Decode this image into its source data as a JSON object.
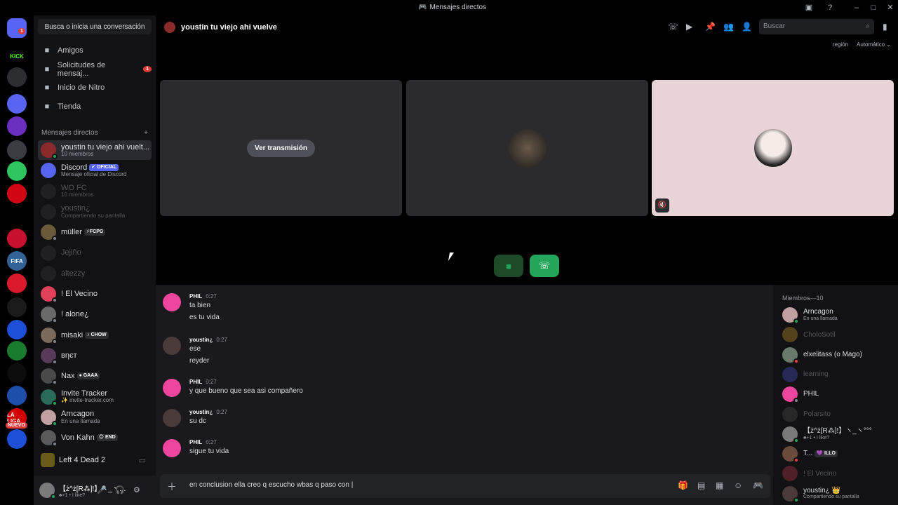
{
  "window": {
    "title": "Mensajes directos"
  },
  "server_rail": {
    "items": [
      {
        "label": "",
        "color": "#5865f2",
        "icon": "discord-home-icon",
        "badge": "1"
      },
      {
        "label": "KICK",
        "color": "#000000",
        "text_color": "#53fc18",
        "icon": "kick-icon"
      },
      {
        "label": "",
        "color": "#2b2d31",
        "icon": "server-group-icon"
      },
      {
        "label": "",
        "color": "#5865f2",
        "icon": "folder-icon"
      },
      {
        "label": "",
        "color": "#6b2fbf",
        "icon": "server-icon"
      },
      {
        "label": "",
        "color": "#3b3c42",
        "icon": "server-icon"
      },
      {
        "label": "",
        "color": "#2fc45d",
        "icon": "premier-league-icon"
      },
      {
        "label": "",
        "color": "#d20515",
        "icon": "bundesliga-icon"
      },
      {
        "label": "",
        "color": "#000000",
        "icon": "laliga-icon"
      },
      {
        "label": "",
        "color": "#c8102e",
        "icon": "server-icon"
      },
      {
        "label": "FIFA",
        "color": "#326295",
        "icon": "fifa-icon"
      },
      {
        "label": "",
        "color": "#d91a2a",
        "icon": "server-icon"
      },
      {
        "label": "",
        "color": "#1b1b1b",
        "icon": "server-icon"
      },
      {
        "label": "",
        "color": "#1e4fd8",
        "icon": "server-icon"
      },
      {
        "label": "",
        "color": "#1a7a2d",
        "icon": "server-icon"
      },
      {
        "label": "",
        "color": "#0d0d0d",
        "icon": "server-icon"
      },
      {
        "label": "",
        "color": "#1f4ea8",
        "icon": "server-icon"
      },
      {
        "label": "LA LIGA",
        "color": "#d30000",
        "icon": "laliga-icon",
        "badge": "NUEVO"
      },
      {
        "label": "",
        "color": "#1e4fd8",
        "icon": "server-icon"
      }
    ]
  },
  "sidebar": {
    "search_label": "Busca o inicia una conversación",
    "nav": [
      {
        "label": "Amigos",
        "icon": "friends-icon"
      },
      {
        "label": "Solicitudes de mensaj...",
        "icon": "inbox-icon",
        "badge": "1"
      },
      {
        "label": "Inicio de Nitro",
        "icon": "nitro-icon"
      },
      {
        "label": "Tienda",
        "icon": "shop-icon"
      }
    ],
    "dm_header": "Mensajes directos",
    "dms": [
      {
        "name": "youstin tu viejo ahi vuelt...",
        "sub": "10 miembros",
        "color": "#8a2a2a",
        "active": true,
        "dim": false,
        "status": "#23a55a"
      },
      {
        "name": "Discord",
        "tag": "✔ OFICIAL",
        "sub": "Mensaje oficial de Discord",
        "color": "#5865f2",
        "dim": false
      },
      {
        "name": "WO FC",
        "sub": "10 miembros",
        "color": "#3b3c42",
        "dim": true
      },
      {
        "name": "youstin¿",
        "sub": "Compartiendo su pantalla",
        "color": "#3b3c42",
        "dim": true
      },
      {
        "name": "müller",
        "tag": "⚡FCPG",
        "sub": "",
        "color": "#6a5a3a",
        "dim": false,
        "status": "#80848e"
      },
      {
        "name": "Jejiño",
        "sub": "",
        "color": "#3b3c42",
        "dim": true
      },
      {
        "name": "altezzy",
        "sub": "",
        "color": "#3b3c42",
        "dim": true
      },
      {
        "name": "! El Vecino",
        "sub": "",
        "color": "#e0405a",
        "dim": false,
        "status": "#80848e"
      },
      {
        "name": "! alone¿",
        "sub": "",
        "color": "#6a6a6a",
        "dim": false,
        "status": "#80848e"
      },
      {
        "name": "misaki",
        "tag": "♪ CHOW",
        "sub": "",
        "color": "#7a6a5a",
        "dim": false,
        "status": "#80848e"
      },
      {
        "name": "вηєт",
        "sub": "",
        "color": "#5a3a5a",
        "dim": false,
        "status": "#80848e"
      },
      {
        "name": "Nax",
        "tag": "● GAAA",
        "sub": "",
        "color": "#4a4a4a",
        "dim": false,
        "status": "#80848e"
      },
      {
        "name": "Invite Tracker",
        "sub": "✨ invite-tracker.com",
        "color": "#2a6a5a",
        "dim": false,
        "status": "#23a55a"
      },
      {
        "name": "Arncagon",
        "sub": "En una llamada",
        "color": "#c0a0a0",
        "dim": false,
        "status": "#23a55a"
      },
      {
        "name": "Von Kahn",
        "tag": "😊 END",
        "sub": "",
        "color": "#5a5a5a",
        "dim": false,
        "status": "#80848e"
      }
    ],
    "game": "Left 4 Dead 2",
    "user": {
      "name": "【ż^ż[R⁂]!】ヽ_ヽ…",
      "status": "♣+1 • I like?"
    }
  },
  "header": {
    "channel_title": "youstin tu viejo ahi vuelve",
    "search_placeholder": "Buscar",
    "region_label": "región",
    "region_value": "Automático ⌄"
  },
  "call": {
    "stream_button": "Ver transmisión",
    "tile_colors": [
      "#2b2b2d",
      "#2b2b2d",
      "#e8d4d6"
    ]
  },
  "messages": [
    {
      "author": "PHIL",
      "time": "0:27",
      "lines": [
        "ta bien",
        "es tu vida"
      ],
      "color": "#eb459e"
    },
    {
      "author": "youstin¿",
      "time": "0:27",
      "lines": [
        "ese",
        "reyder"
      ],
      "color": "#4a3a3a"
    },
    {
      "author": "PHIL",
      "time": "0:27",
      "lines": [
        "y que bueno que sea asi compañero"
      ],
      "color": "#eb459e"
    },
    {
      "author": "youstin¿",
      "time": "0:27",
      "lines": [
        "su dc"
      ],
      "color": "#4a3a3a"
    },
    {
      "author": "PHIL",
      "time": "0:27",
      "lines": [
        "sigue tu vida"
      ],
      "color": "#eb459e"
    }
  ],
  "composer": {
    "value": "en conclusion ella creo q escucho wbas q paso con |"
  },
  "members": {
    "header": "Miembros—10",
    "list": [
      {
        "name": "Arncagon",
        "sub": "En una llamada",
        "color": "#c0a0a0",
        "dim": false,
        "status": "#23a55a"
      },
      {
        "name": "CholoSotil",
        "sub": "",
        "color": "#f0b232",
        "dim": true
      },
      {
        "name": "elxelitass (o Mago)",
        "sub": "",
        "color": "#6a7a6a",
        "dim": false,
        "status": "#f23f43"
      },
      {
        "name": "learning",
        "sub": "",
        "color": "#5865f2",
        "dim": true
      },
      {
        "name": "PHIL",
        "sub": "",
        "color": "#eb459e",
        "dim": false,
        "status": "#80848e"
      },
      {
        "name": "Polarsito",
        "sub": "",
        "color": "#5a5a5a",
        "dim": true
      },
      {
        "name": "【ż^ż[R⁂]!】ヽ_ヽ°°°",
        "sub": "♣+1 • I like?",
        "color": "#7a7a7a",
        "dim": false,
        "status": "#23a55a"
      },
      {
        "name": "T...",
        "tag": "💜 ILLO",
        "sub": "",
        "color": "#6a4a3a",
        "dim": false,
        "status": "#f23f43"
      },
      {
        "name": "! El Vecino",
        "sub": "",
        "color": "#e0405a",
        "dim": true
      },
      {
        "name": "youstin¿ 👑",
        "sub": "Compartiendo su pantalla",
        "color": "#4a3a3a",
        "dim": false,
        "status": "#23a55a"
      }
    ]
  }
}
